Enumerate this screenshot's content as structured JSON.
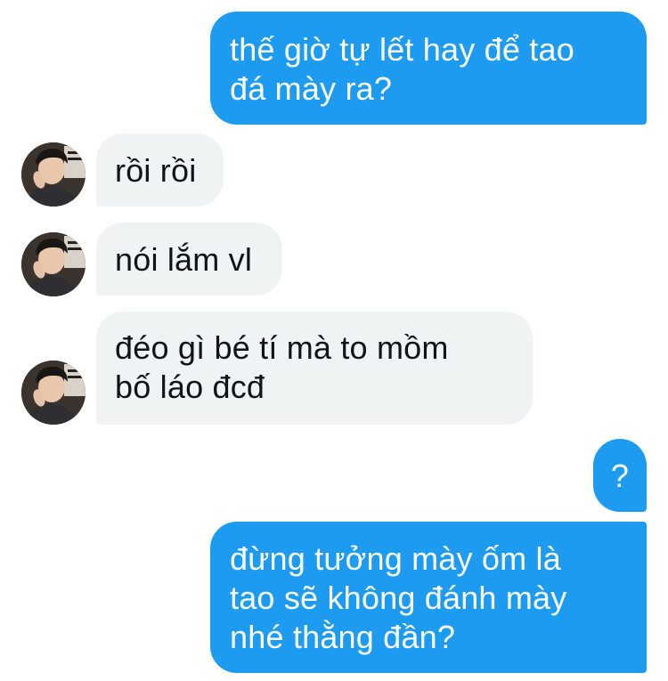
{
  "conversation": {
    "messages": [
      {
        "sender": "me",
        "text": "thế giờ tự lết hay để tao\nđá mày ra?"
      },
      {
        "sender": "other",
        "text": "rồi rồi"
      },
      {
        "sender": "other",
        "text": "nói lắm vl"
      },
      {
        "sender": "other",
        "text": "đéo gì bé tí mà to mồm\nbố láo đcđ"
      },
      {
        "sender": "me",
        "text": "?"
      },
      {
        "sender": "me",
        "text": "đừng tưởng mày ốm là\ntao sẽ không đánh mày\nnhé thằng đần?"
      }
    ],
    "colors": {
      "sent_bubble": "#1d9bf0",
      "sent_text": "#ffffff",
      "received_bubble": "#eff3f4",
      "received_text": "#0f1419"
    },
    "icons": {
      "contact_avatar": "profile-photo"
    }
  }
}
